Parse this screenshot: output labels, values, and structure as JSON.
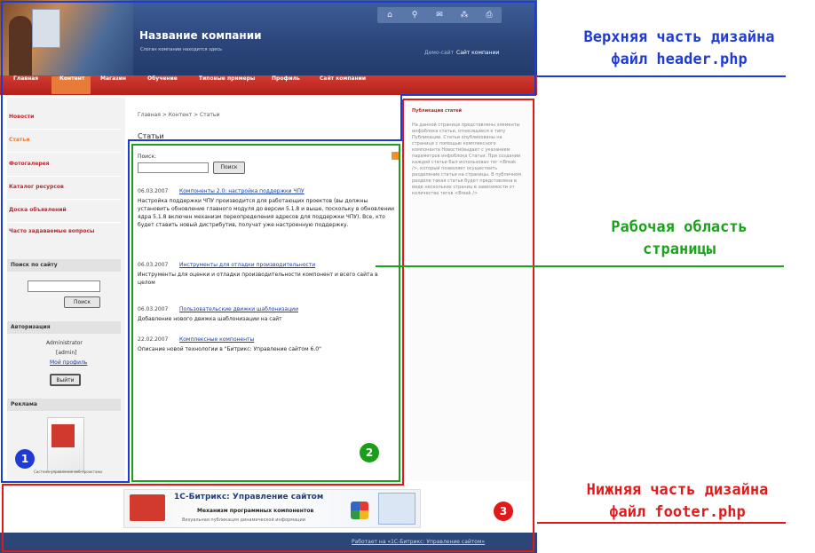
{
  "colors": {
    "header_outline": "#1f3bd6",
    "work_outline": "#1aa31a",
    "footer_outline": "#e01a1a",
    "nav_red": "#c0272d",
    "nav_active": "#e87a3a",
    "header_blue": "#2c467b"
  },
  "header": {
    "company_name": "Название компании",
    "slogan": "Слоган компании находится здесь",
    "demo_label": "Демо-сайт",
    "site_label": "Сайт компании",
    "icons": [
      "home-icon",
      "search-icon",
      "mail-icon",
      "sitemap-icon",
      "print-icon"
    ]
  },
  "nav": {
    "items": [
      "Главная",
      "Контент",
      "Магазин",
      "Обучение",
      "Типовые примеры",
      "Профиль",
      "Сайт компании"
    ],
    "active": "Контент"
  },
  "left_menu": {
    "items": [
      "Новости",
      "Статьи",
      "Фотогалерея",
      "Каталог ресурсов",
      "Доска объявлений",
      "Часто задаваемые вопросы"
    ],
    "active": "Статьи"
  },
  "site_search": {
    "heading": "Поиск по сайту",
    "button": "Поиск"
  },
  "auth": {
    "heading": "Авторизация",
    "user": "Administrator",
    "login": "[admin]",
    "profile_link": "Мой профиль",
    "logout_button": "Выйти"
  },
  "ads": {
    "heading": "Реклама",
    "caption": "Система управления веб-проектами"
  },
  "content": {
    "breadcrumb": "Главная > Контент > Статьи",
    "page_title": "Статьи",
    "search_label": "Поиск:",
    "search_button": "Поиск",
    "news": [
      {
        "date": "06.03.2007",
        "title": "Компоненты 2.0: настройка поддержки ЧПУ",
        "text": "Настройка поддержки ЧПУ производится для работающих проектов (вы должны установить обновление главного модуля до версии 5.1.8 и выше, поскольку в обновлении ядра 5.1.8 включен механизм переопределения адресов для поддержки ЧПУ). Все, кто будет ставить новый дистрибутив, получат уже настроенную поддержку."
      },
      {
        "date": "06.03.2007",
        "title": "Инструменты для отладки производительности",
        "text": "Инструменты для оценки и отладки производительности компонент и всего сайта в целом"
      },
      {
        "date": "06.03.2007",
        "title": "Пользовательские движки шаблонизации",
        "text": "Добавление нового движка шаблонизации на сайт"
      },
      {
        "date": "22.02.2007",
        "title": "Комплексные компоненты",
        "text": "Описание новой технологии в \"Битрикс: Управление сайтом 6.0\""
      }
    ]
  },
  "right_column": {
    "title": "Публикация статей",
    "text": "На данной странице представлены элементы инфоблока статьи, относящиеся к типу Публикации. Статьи опубликованы на странице с помощью комплексного компонента Новости(выдает с указанием параметров инфоблока Статьи. При создании каждой статьи был использован тег <Break />, который позволяет осуществить разделение статьи на страницы. В публичном разделе такая статья будет представлена в виде нескольких страниц в зависимости от количества тегов <Break />"
  },
  "footer": {
    "banner_title": "1С-Битрикс: Управление сайтом",
    "banner_sub": "Механизм программных компонентов",
    "banner_sub2": "Визуальная публикация динамической информации",
    "link": "Работает на «1С-Битрикс: Управление сайтом»"
  },
  "markers": [
    "1",
    "2",
    "3"
  ],
  "callouts": {
    "header": [
      "Верхняя часть дизайна",
      "файл header.php"
    ],
    "work": [
      "Рабочая область",
      "страницы"
    ],
    "footer": [
      "Нижняя часть дизайна",
      "файл footer.php"
    ]
  }
}
